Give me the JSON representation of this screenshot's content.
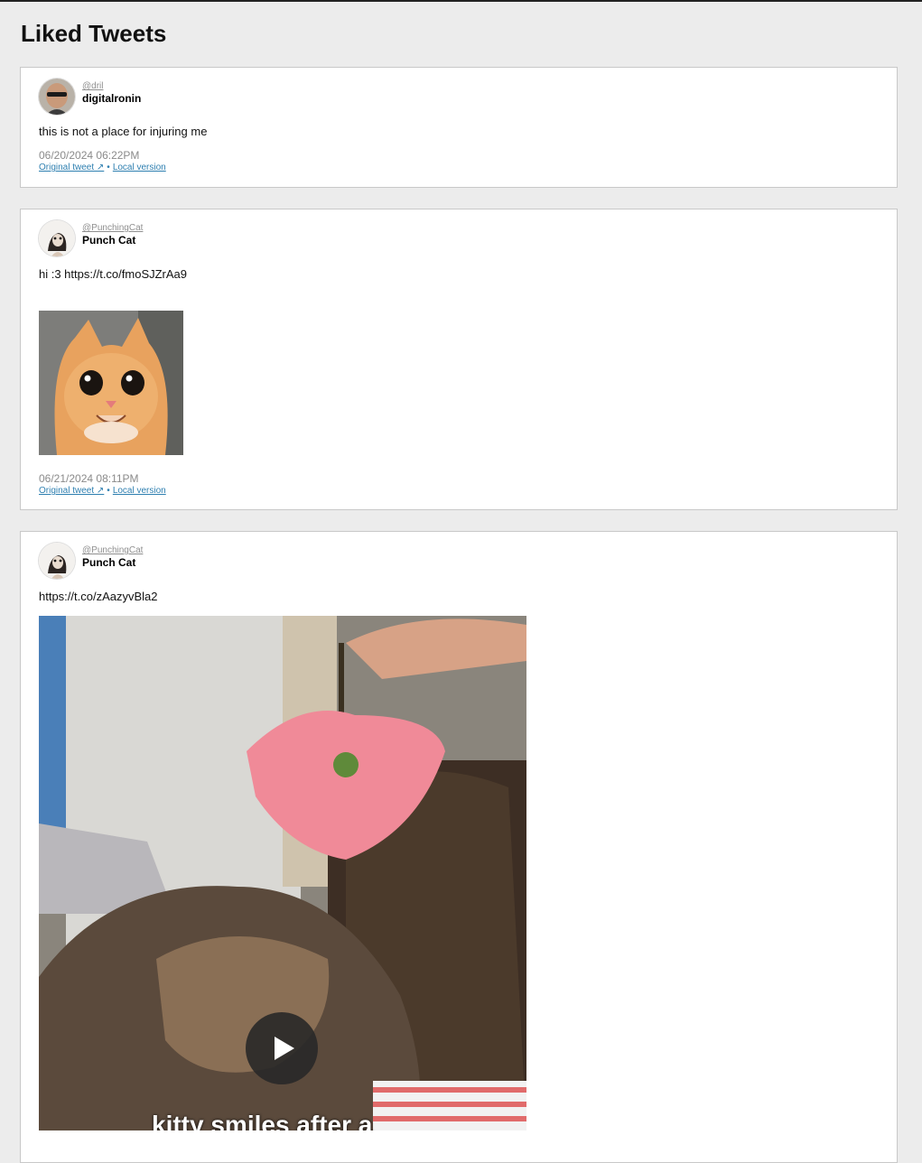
{
  "page": {
    "title": "Liked Tweets"
  },
  "tweets": [
    {
      "handle": "@dril",
      "name": "digitalronin",
      "text": "this is not a place for injuring me",
      "timestamp": "06/20/2024 06:22PM",
      "original_link": "Original tweet ↗",
      "separator": "•",
      "local_link": "Local version"
    },
    {
      "handle": "@PunchingCat",
      "name": "Punch Cat",
      "text": "hi :3 https://t.co/fmoSJZrAa9",
      "media": {
        "type": "photo"
      },
      "timestamp": "06/21/2024 08:11PM",
      "original_link": "Original tweet ↗",
      "separator": "•",
      "local_link": "Local version"
    },
    {
      "handle": "@PunchingCat",
      "name": "Punch Cat",
      "text": "https://t.co/zAazyvBla2",
      "media": {
        "type": "video",
        "caption": "kitty smiles after a"
      }
    }
  ],
  "icons": {
    "play": "play-icon"
  },
  "colors": {
    "link": "#2e7fb0",
    "muted": "#8a8a8a",
    "background": "#ececec"
  }
}
